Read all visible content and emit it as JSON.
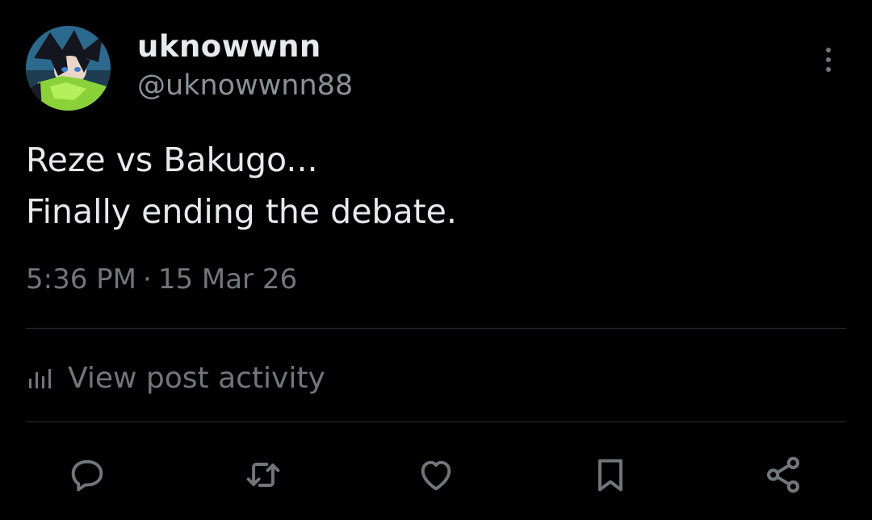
{
  "author": {
    "display_name": "uknowwnn",
    "handle": "@uknowwnn88",
    "avatar_icon": "avatar-image"
  },
  "post": {
    "text_lines": [
      "Reze vs Bakugo...",
      "Finally ending the debate."
    ],
    "time": "5:36 PM",
    "separator": "·",
    "date": "15 Mar 26"
  },
  "activity": {
    "label": "View post activity",
    "icon": "bar-chart-icon"
  },
  "actions": [
    {
      "icon": "reply-icon"
    },
    {
      "icon": "repost-icon"
    },
    {
      "icon": "like-icon"
    },
    {
      "icon": "bookmark-icon"
    },
    {
      "icon": "share-icon"
    }
  ],
  "menu_icon": "more-vertical-icon",
  "colors": {
    "background": "#000000",
    "primary_text": "#e7e9ea",
    "secondary_text": "#71767b",
    "divider": "#2f3336"
  }
}
